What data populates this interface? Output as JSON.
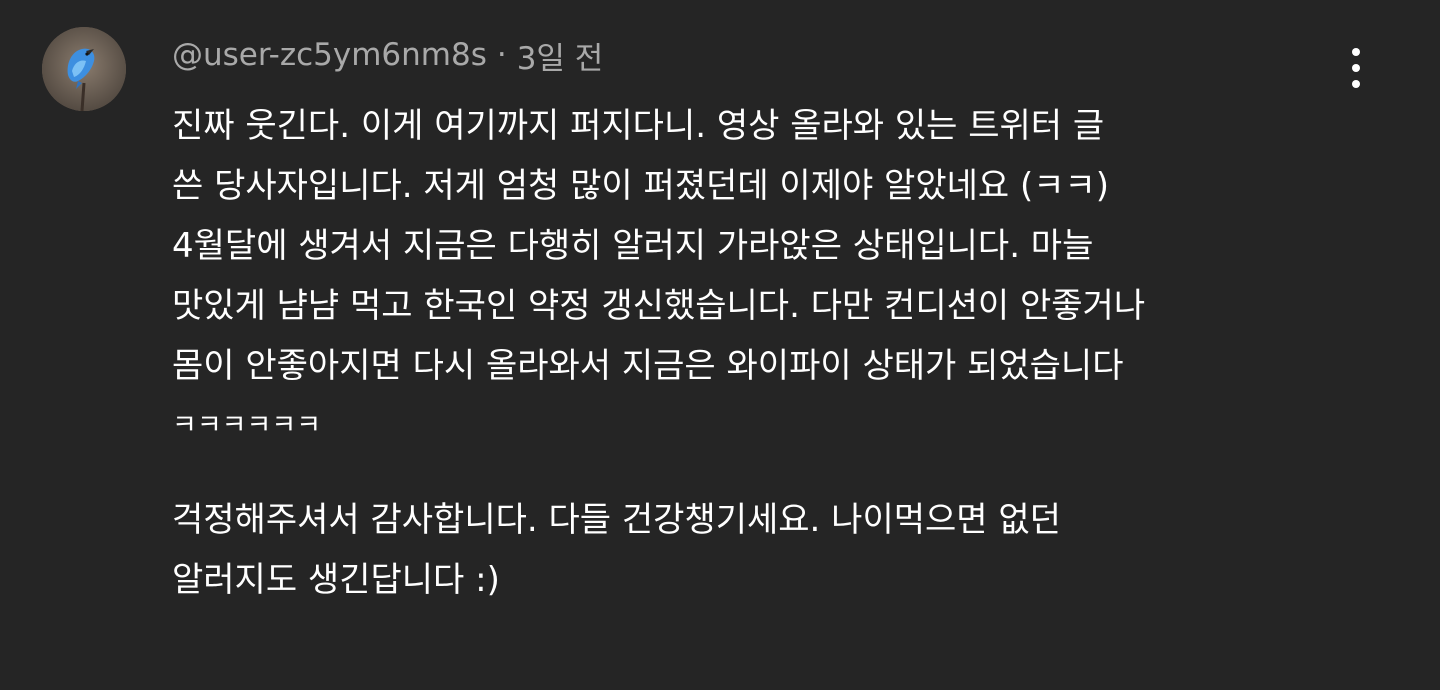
{
  "comment": {
    "author": "@user-zc5ym6nm8s",
    "separator": "·",
    "time": "3일 전",
    "more_icon": "vertical-ellipsis-icon",
    "avatar_icon": "bluebird-avatar",
    "paragraph1": [
      "진짜 웃긴다. 이게 여기까지 퍼지다니. 영상 올라와 있는 트위터 글",
      "쓴 당사자입니다. 저게 엄청 많이 퍼졌던데 이제야 알았네요 (ㅋㅋ)",
      "4월달에 생겨서 지금은 다행히 알러지 가라앉은 상태입니다. 마늘",
      "맛있게 냠냠 먹고 한국인 약정 갱신했습니다. 다만 컨디션이 안좋거나",
      "몸이 안좋아지면 다시 올라와서 지금은 와이파이 상태가 되었습니다",
      "ㅋㅋㅋㅋㅋㅋ"
    ],
    "paragraph2": [
      "걱정해주셔서 감사합니다. 다들 건강챙기세요. 나이먹으면 없던",
      "알러지도 생긴답니다 :)"
    ]
  },
  "colors": {
    "background": "#252525",
    "text": "#ffffff",
    "meta": "#a9a9a9"
  }
}
